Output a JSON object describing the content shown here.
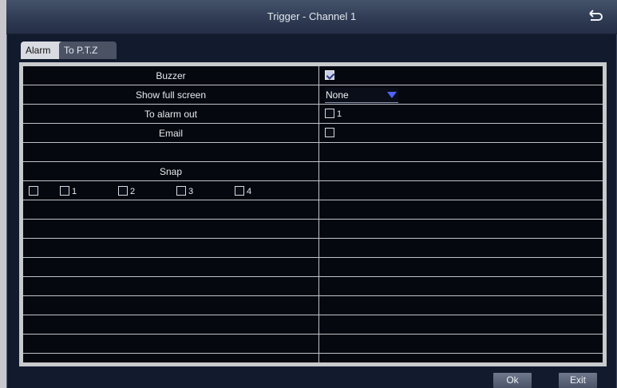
{
  "window": {
    "title": "Trigger - Channel 1"
  },
  "tabs": [
    {
      "label": "Alarm",
      "active": true
    },
    {
      "label": "To P.T.Z",
      "active": false
    }
  ],
  "rows": {
    "buzzer": {
      "label": "Buzzer",
      "checked": true
    },
    "show_full_screen": {
      "label": "Show full screen",
      "value": "None"
    },
    "to_alarm_out": {
      "label": "To alarm out",
      "options": [
        {
          "num": "1",
          "checked": false
        }
      ]
    },
    "email": {
      "label": "Email",
      "checked": false
    },
    "snap": {
      "label": "Snap",
      "options": [
        {
          "num": "",
          "checked": false
        },
        {
          "num": "1",
          "checked": false
        },
        {
          "num": "2",
          "checked": false
        },
        {
          "num": "3",
          "checked": false
        },
        {
          "num": "4",
          "checked": false
        }
      ]
    }
  },
  "buttons": {
    "ok": "Ok",
    "exit": "Exit"
  },
  "colors": {
    "background": "#121b2e",
    "titlebar": "#2e3a52",
    "accent": "#4f63ff"
  },
  "icons": {
    "back": "return-arrow-icon",
    "dropdown": "triangle-down-icon"
  }
}
